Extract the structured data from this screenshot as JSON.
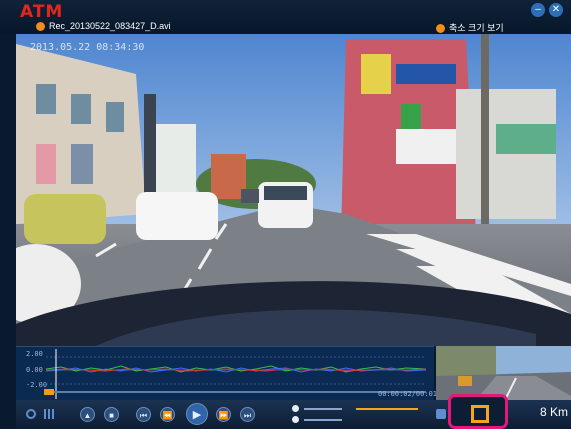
{
  "app": {
    "logo": "ATM"
  },
  "file": {
    "name": "Rec_20130522_083427_D.avi",
    "small_view_label": "축소 크기 보기"
  },
  "video": {
    "timestamp": "2013.05.22  08:34:30"
  },
  "graph": {
    "axis_labels": [
      "2.00",
      "0.00",
      "-2.00"
    ],
    "time": "00:00:02/00:01:01"
  },
  "controls": {
    "speed": "8 Km"
  },
  "icons": [
    "minimize-icon",
    "close-icon",
    "settings-icon",
    "grid-icon",
    "eject-icon",
    "stop-icon",
    "prev-icon",
    "rewind-icon",
    "play-icon",
    "fast-forward-icon",
    "next-icon",
    "volume-icon",
    "brightness-icon",
    "camera-icon",
    "speed-icon"
  ]
}
